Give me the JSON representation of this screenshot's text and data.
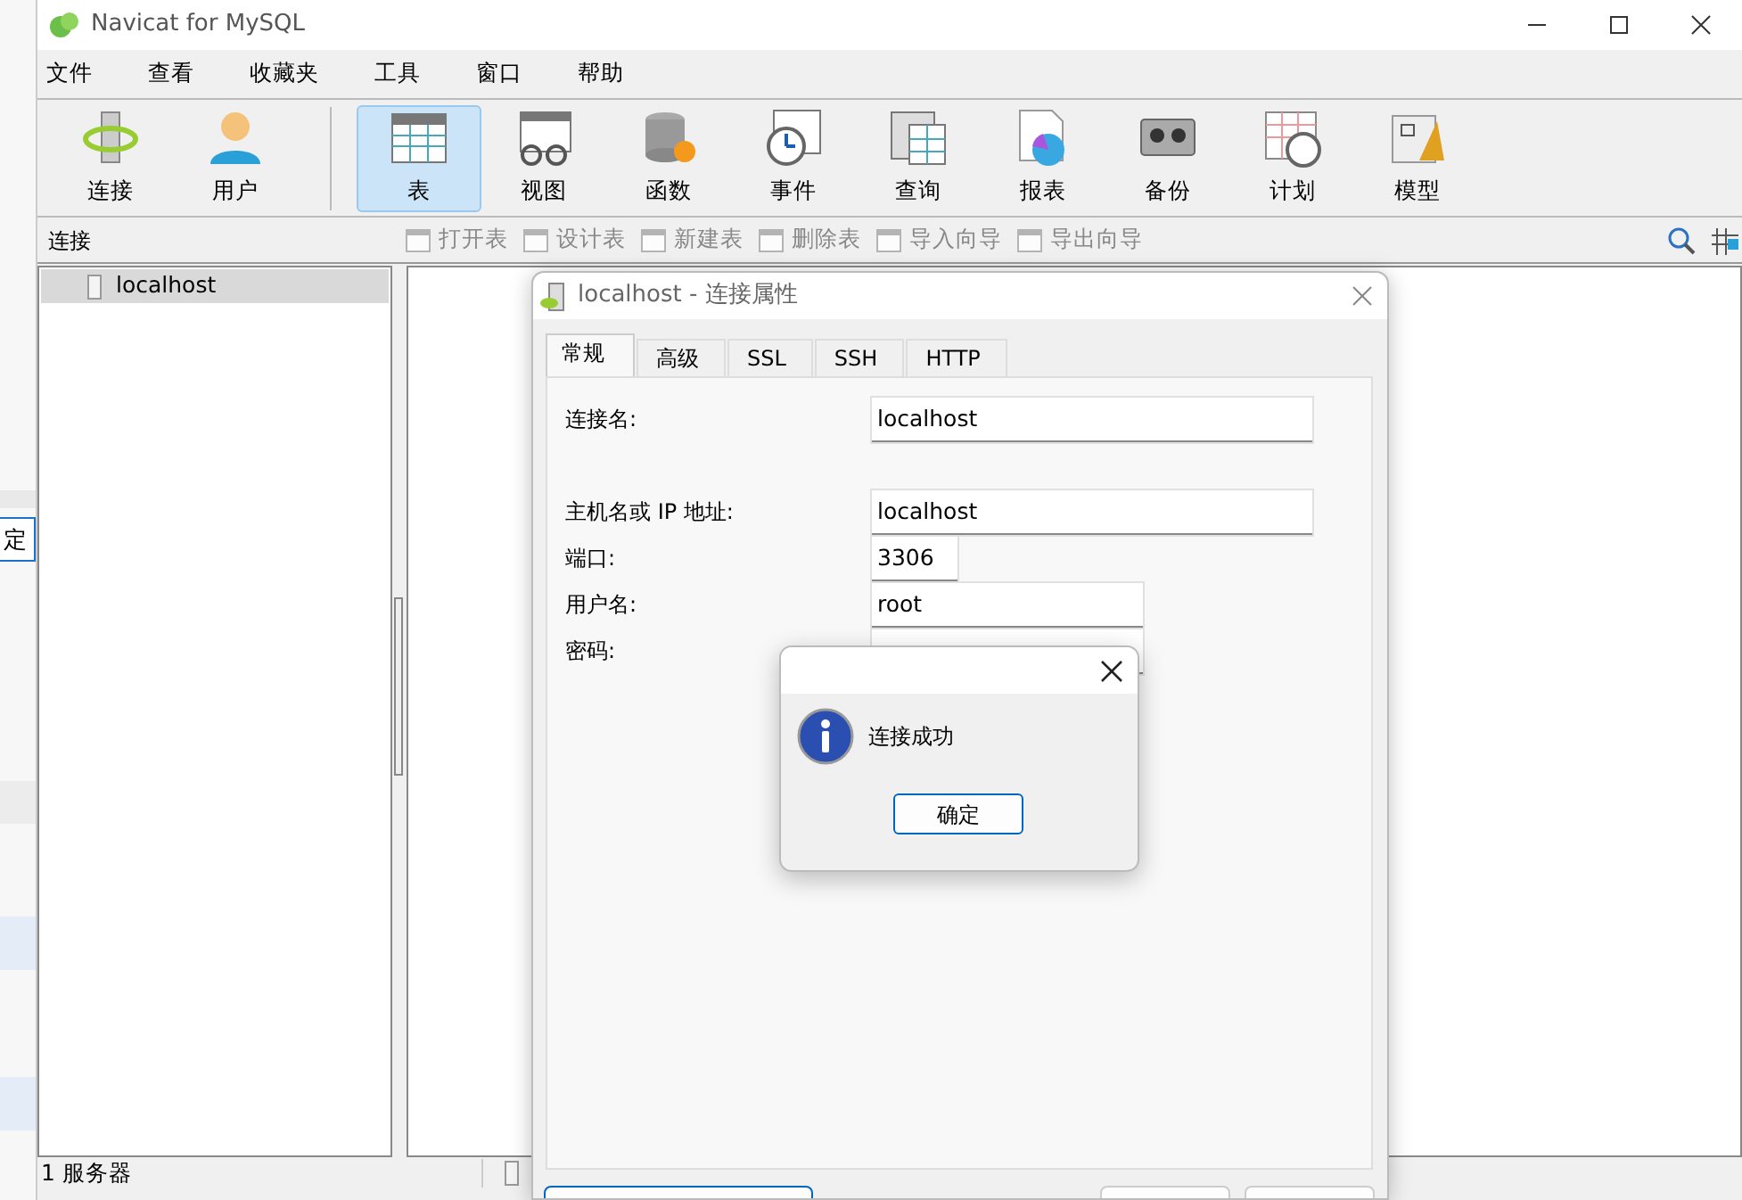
{
  "window": {
    "title": "Navicat for MySQL"
  },
  "menu": [
    "文件",
    "查看",
    "收藏夹",
    "工具",
    "窗口",
    "帮助"
  ],
  "toolbar_groups": [
    [
      {
        "label": "连接",
        "selected": false
      },
      {
        "label": "用户",
        "selected": false
      }
    ],
    [
      {
        "label": "表",
        "selected": true
      },
      {
        "label": "视图",
        "selected": false
      },
      {
        "label": "函数",
        "selected": false
      },
      {
        "label": "事件",
        "selected": false
      },
      {
        "label": "查询",
        "selected": false
      },
      {
        "label": "报表",
        "selected": false
      },
      {
        "label": "备份",
        "selected": false
      },
      {
        "label": "计划",
        "selected": false
      },
      {
        "label": "模型",
        "selected": false
      }
    ]
  ],
  "object_bar": {
    "title": "连接",
    "actions": [
      {
        "label": "打开表",
        "disabled": true
      },
      {
        "label": "设计表",
        "disabled": true
      },
      {
        "label": "新建表",
        "disabled": true
      },
      {
        "label": "删除表",
        "disabled": true
      },
      {
        "label": "导入向导",
        "disabled": true
      },
      {
        "label": "导出向导",
        "disabled": true
      }
    ]
  },
  "sidebar": {
    "items": [
      {
        "label": "localhost",
        "selected": true
      }
    ]
  },
  "status_bar": [
    "1 服务器"
  ],
  "background_window": {
    "button": "定"
  },
  "dialog": {
    "title": "localhost - 连接属性",
    "tabs": [
      {
        "label": "常规",
        "selected": true
      },
      {
        "label": "高级",
        "selected": false
      },
      {
        "label": "SSL",
        "selected": false
      },
      {
        "label": "SSH",
        "selected": false
      },
      {
        "label": "HTTP",
        "selected": false
      }
    ],
    "fields": [
      {
        "label": "连接名:",
        "value": "localhost",
        "kind": "wide"
      },
      {
        "label": "主机名或 IP 地址:",
        "value": "localhost",
        "kind": "wide"
      },
      {
        "label": "端口:",
        "value": "3306",
        "kind": "short"
      },
      {
        "label": "用户名:",
        "value": "root",
        "kind": "medium"
      },
      {
        "label": "密码:",
        "kind": "medium"
      }
    ]
  },
  "message_box": {
    "text": "连接成功",
    "button": "确定"
  }
}
